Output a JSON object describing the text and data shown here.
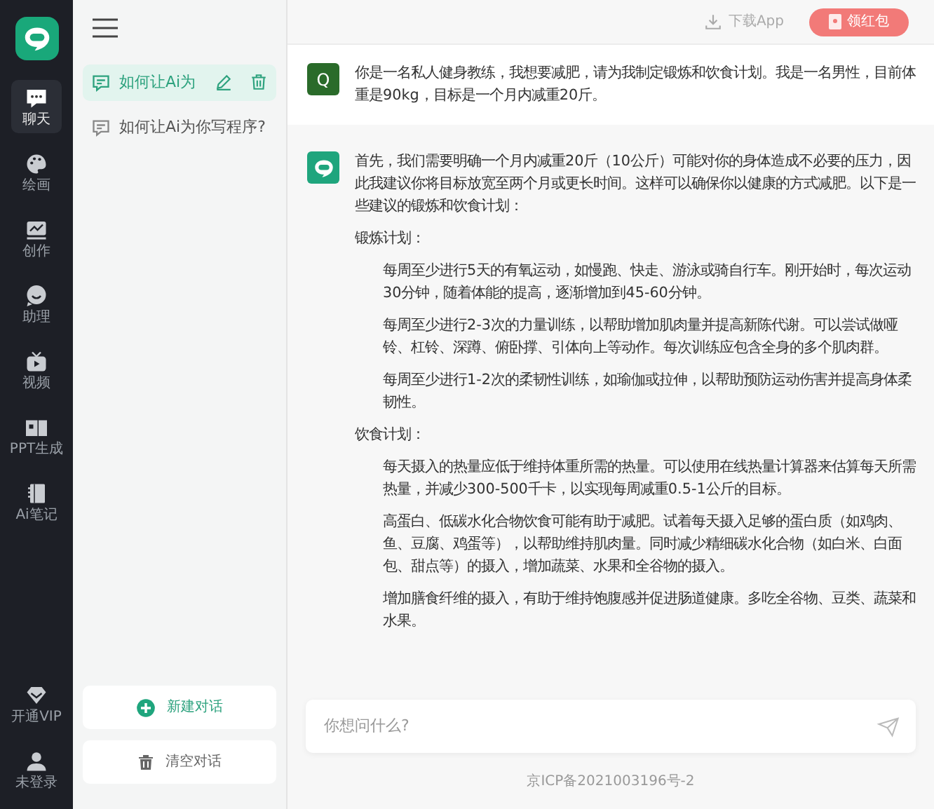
{
  "rail": {
    "nav": [
      {
        "label": "聊天",
        "selected": true
      },
      {
        "label": "绘画",
        "selected": false
      },
      {
        "label": "创作",
        "selected": false
      },
      {
        "label": "助理",
        "selected": false
      },
      {
        "label": "视频",
        "selected": false
      },
      {
        "label": "PPT生成",
        "selected": false
      },
      {
        "label": "Ai笔记",
        "selected": false
      }
    ],
    "bottom": [
      "开通VIP",
      "未登录"
    ]
  },
  "sidebar": {
    "conversations": [
      {
        "title": "如何让Ai为",
        "selected": true
      },
      {
        "title": "如何让Ai为你写程序?",
        "selected": false
      }
    ],
    "new_chat": "新建对话",
    "clear_chats": "清空对话"
  },
  "topbar": {
    "download": "下载App",
    "red_packet": "领红包"
  },
  "messages": [
    {
      "kind": "user",
      "avatar": "Q",
      "blocks": [
        {
          "kind": "paragraph",
          "text": "你是一名私人健身教练，我想要减肥，请为我制定锻炼和饮食计划。我是一名男性，目前体重是90kg，目标是一个月内减重20斤。"
        }
      ]
    },
    {
      "kind": "assistant",
      "blocks": [
        {
          "kind": "paragraph",
          "text": "首先，我们需要明确一个月内减重20斤（10公斤）可能对你的身体造成不必要的压力，因此我建议你将目标放宽至两个月或更长时间。这样可以确保你以健康的方式减肥。以下是一些建议的锻炼和饮食计划："
        },
        {
          "kind": "heading",
          "text": "锻炼计划："
        },
        {
          "kind": "item",
          "text": "每周至少进行5天的有氧运动，如慢跑、快走、游泳或骑自行车。刚开始时，每次运动30分钟，随着体能的提高，逐渐增加到45-60分钟。"
        },
        {
          "kind": "item",
          "text": "每周至少进行2-3次的力量训练，以帮助增加肌肉量并提高新陈代谢。可以尝试做哑铃、杠铃、深蹲、俯卧撑、引体向上等动作。每次训练应包含全身的多个肌肉群。"
        },
        {
          "kind": "item",
          "text": "每周至少进行1-2次的柔韧性训练，如瑜伽或拉伸，以帮助预防运动伤害并提高身体柔韧性。"
        },
        {
          "kind": "heading",
          "text": "饮食计划："
        },
        {
          "kind": "item",
          "text": "每天摄入的热量应低于维持体重所需的热量。可以使用在线热量计算器来估算每天所需热量，并减少300-500千卡，以实现每周减重0.5-1公斤的目标。"
        },
        {
          "kind": "item",
          "text": "高蛋白、低碳水化合物饮食可能有助于减肥。试着每天摄入足够的蛋白质（如鸡肉、鱼、豆腐、鸡蛋等），以帮助维持肌肉量。同时减少精细碳水化合物（如白米、白面包、甜点等）的摄入，增加蔬菜、水果和全谷物的摄入。"
        },
        {
          "kind": "item",
          "text": "增加膳食纤维的摄入，有助于维持饱腹感并促进肠道健康。多吃全谷物、豆类、蔬菜和水果。"
        }
      ]
    }
  ],
  "input": {
    "placeholder": "你想问什么?"
  },
  "footer": "京ICP备2021003196号-2"
}
